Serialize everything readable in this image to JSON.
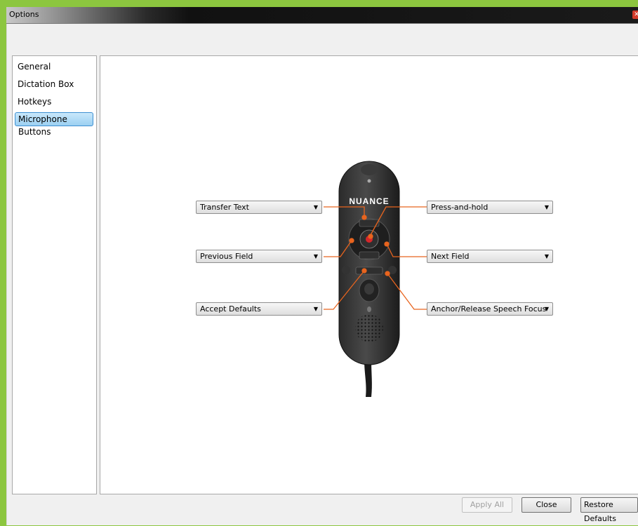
{
  "window": {
    "title": "Options"
  },
  "sidebar": {
    "items": [
      {
        "label": "General"
      },
      {
        "label": "Dictation Box"
      },
      {
        "label": "Hotkeys"
      },
      {
        "label": "Microphone Buttons",
        "selected": true
      }
    ]
  },
  "microphone": {
    "brand": "NUANCE",
    "dropdowns": {
      "transfer_text": "Transfer Text",
      "previous_field": "Previous Field",
      "accept_defaults": "Accept Defaults",
      "press_and_hold": "Press-and-hold",
      "next_field": "Next Field",
      "anchor_release": "Anchor/Release Speech Focus"
    }
  },
  "buttons": {
    "apply_all": "Apply All",
    "close": "Close",
    "restore_defaults": "Restore Defaults"
  },
  "colors": {
    "accent_orange": "#e8641e",
    "selection_blue": "#3d8fd1",
    "frame_green": "#8cc63f"
  }
}
